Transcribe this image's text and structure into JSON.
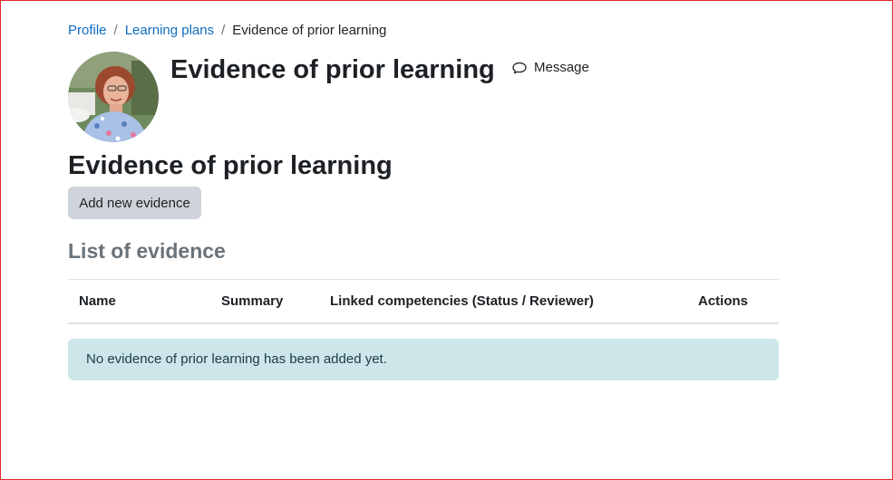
{
  "breadcrumb": {
    "items": [
      {
        "label": "Profile"
      },
      {
        "label": "Learning plans"
      }
    ],
    "separator": "/",
    "current": "Evidence of prior learning"
  },
  "header": {
    "title": "Evidence of prior learning",
    "message_label": "Message"
  },
  "section": {
    "title": "Evidence of prior learning",
    "add_button_label": "Add new evidence",
    "list_title": "List of evidence"
  },
  "table": {
    "columns": [
      "Name",
      "Summary",
      "Linked competencies (Status / Reviewer)",
      "Actions"
    ]
  },
  "alert": {
    "text": "No evidence of prior learning has been added yet."
  },
  "colors": {
    "link": "#0f6cbf",
    "button_bg": "#ced4da",
    "alert_bg": "#cce6ea",
    "frame_border": "#e0282e"
  },
  "icons": {
    "message": "speech-bubble-icon",
    "avatar": "user-avatar"
  }
}
